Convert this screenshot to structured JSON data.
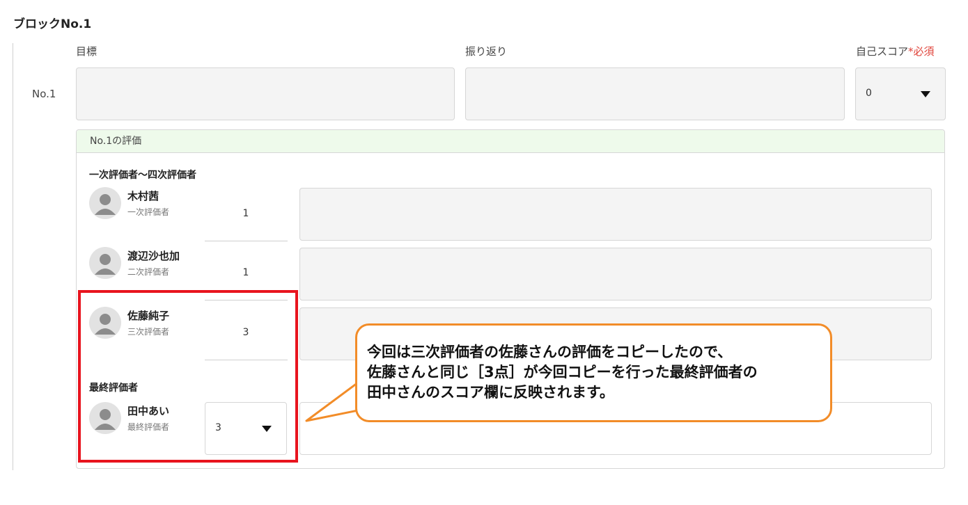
{
  "block": {
    "title": "ブロックNo.1"
  },
  "columns": {
    "goal": "目標",
    "review": "振り返り",
    "self_score": "自己スコア",
    "required_mark": "*必須"
  },
  "row": {
    "label": "No.1",
    "self_score_value": "0"
  },
  "evaluation": {
    "header": "No.1の評価",
    "section_evaluators": "一次評価者〜四次評価者",
    "evaluators": [
      {
        "name": "木村茜",
        "role": "一次評価者",
        "score": "1"
      },
      {
        "name": "渡辺沙也加",
        "role": "二次評価者",
        "score": "1"
      },
      {
        "name": "佐藤純子",
        "role": "三次評価者",
        "score": "3"
      }
    ],
    "section_final": "最終評価者",
    "final": {
      "name": "田中あい",
      "role": "最終評価者",
      "score": "3"
    }
  },
  "callout": {
    "lines": [
      "今回は三次評価者の佐藤さんの評価をコピーしたので、",
      "佐藤さんと同じ［3点］が今回コピーを行った最終評価者の",
      "田中さんのスコア欄に反映されます。"
    ],
    "border_color": "#f28c28"
  },
  "colors": {
    "highlight_frame": "#e8141e",
    "panel_header_bg": "#eefaeb",
    "required": "#e0443b"
  }
}
